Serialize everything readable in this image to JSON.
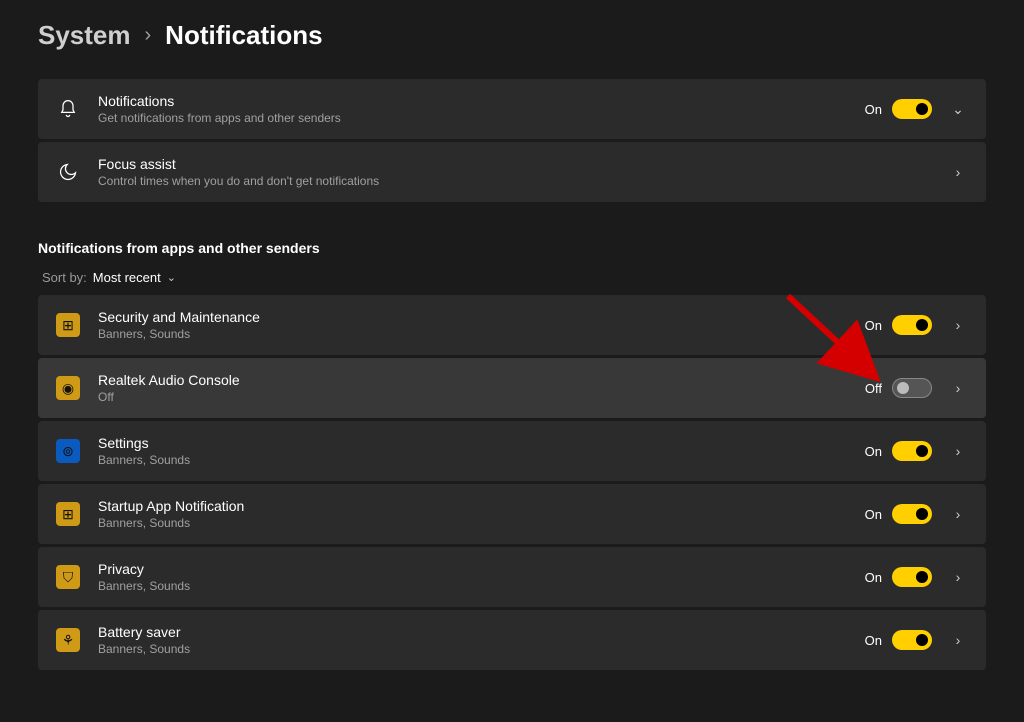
{
  "breadcrumb": {
    "parent": "System",
    "current": "Notifications"
  },
  "main": {
    "notifications": {
      "title": "Notifications",
      "subtitle": "Get notifications from apps and other senders",
      "state": "On"
    },
    "focus": {
      "title": "Focus assist",
      "subtitle": "Control times when you do and don't get notifications"
    }
  },
  "section_label": "Notifications from apps and other senders",
  "sortby": {
    "label": "Sort by:",
    "value": "Most recent"
  },
  "apps": [
    {
      "name": "Security and Maintenance",
      "detail": "Banners, Sounds",
      "state": "On",
      "icon_class": "ico-gold",
      "glyph": "⊞",
      "highlight": false
    },
    {
      "name": "Realtek Audio Console",
      "detail": "Off",
      "state": "Off",
      "icon_class": "ico-gold",
      "glyph": "◉",
      "highlight": true
    },
    {
      "name": "Settings",
      "detail": "Banners, Sounds",
      "state": "On",
      "icon_class": "ico-blue",
      "glyph": "⊚",
      "highlight": false
    },
    {
      "name": "Startup App Notification",
      "detail": "Banners, Sounds",
      "state": "On",
      "icon_class": "ico-gold",
      "glyph": "⊞",
      "highlight": false
    },
    {
      "name": "Privacy",
      "detail": "Banners, Sounds",
      "state": "On",
      "icon_class": "ico-gold",
      "glyph": "⛉",
      "highlight": false
    },
    {
      "name": "Battery saver",
      "detail": "Banners, Sounds",
      "state": "On",
      "icon_class": "ico-gold",
      "glyph": "⚘",
      "highlight": false
    }
  ]
}
